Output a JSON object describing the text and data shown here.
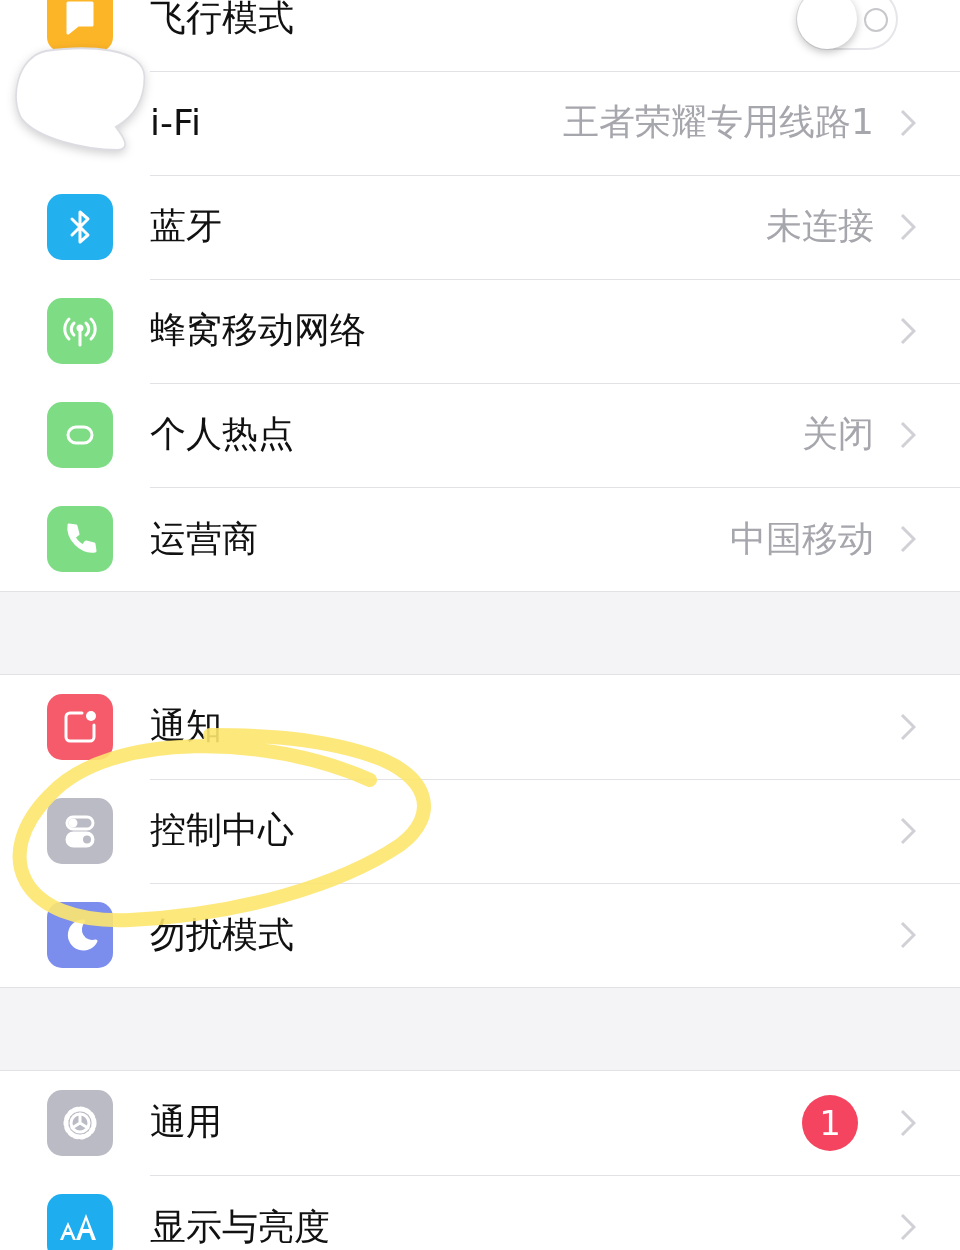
{
  "groups": [
    {
      "rows": [
        {
          "kind": "toggle",
          "label": "飞行模式",
          "on": false
        },
        {
          "kind": "link",
          "label": "i-Fi",
          "value": "王者荣耀专用线路1"
        },
        {
          "kind": "link",
          "label": "蓝牙",
          "value": "未连接"
        },
        {
          "kind": "link",
          "label": "蜂窝移动网络"
        },
        {
          "kind": "link",
          "label": "个人热点",
          "value": "关闭"
        },
        {
          "kind": "link",
          "label": "运营商",
          "value": "中国移动"
        }
      ]
    },
    {
      "rows": [
        {
          "kind": "link",
          "label": "通知"
        },
        {
          "kind": "link",
          "label": "控制中心"
        },
        {
          "kind": "link",
          "label": "勿扰模式"
        }
      ]
    },
    {
      "rows": [
        {
          "kind": "link",
          "label": "通用",
          "badge": "1"
        },
        {
          "kind": "link",
          "label": "显示与亮度"
        }
      ]
    }
  ]
}
